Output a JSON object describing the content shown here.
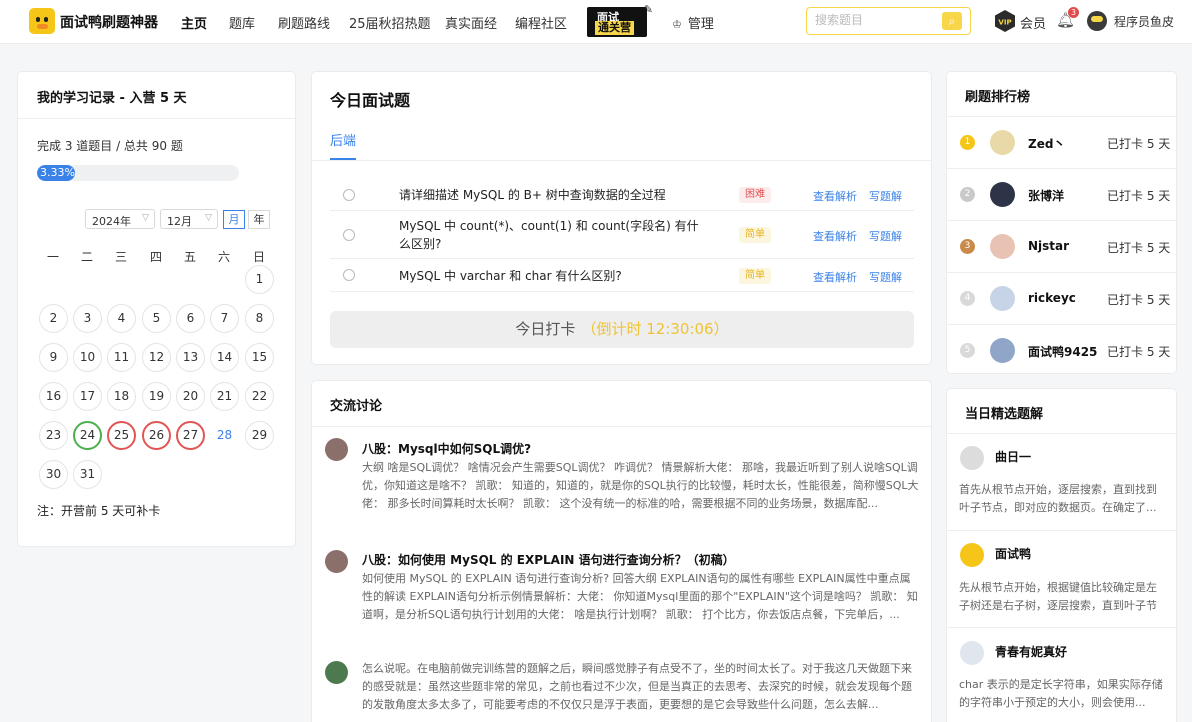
{
  "header": {
    "app_name": "面试鸭刷题神器",
    "nav": [
      "主页",
      "题库",
      "刷题路线",
      "25届秋招热题",
      "真实面经",
      "编程社区"
    ],
    "camp_badge": {
      "line1": "面试",
      "line2": "通关营"
    },
    "admin_label": "管理",
    "search_placeholder": "搜索题目",
    "vip_label": "会员",
    "notification_count": "3",
    "username": "程序员鱼皮"
  },
  "study": {
    "title": "我的学习记录 - 入营 5 天",
    "progress_text": "完成 3 道题目 / 总共 90 题",
    "progress_label": "3.33%",
    "progress_fraction": 0.0333,
    "year": "2024年",
    "month": "12月",
    "mode_month": "月",
    "mode_year": "年",
    "weekdays": [
      "一",
      "二",
      "三",
      "四",
      "五",
      "六",
      "日"
    ],
    "days": [
      "1",
      "2",
      "3",
      "4",
      "5",
      "6",
      "7",
      "8",
      "9",
      "10",
      "11",
      "12",
      "13",
      "14",
      "15",
      "16",
      "17",
      "18",
      "19",
      "20",
      "21",
      "22",
      "23",
      "24",
      "25",
      "26",
      "27",
      "28",
      "29",
      "30",
      "31"
    ],
    "note": "注：开营前 5 天可补卡"
  },
  "today": {
    "title": "今日面试题",
    "tab": "后端",
    "questions": [
      {
        "text": "请详细描述 MySQL 的 B+ 树中查询数据的全过程",
        "tag": "困难",
        "view": "查看解析",
        "write": "写题解"
      },
      {
        "text": "MySQL 中 count(*)、count(1) 和 count(字段名) 有什么区别?",
        "tag": "简单",
        "view": "查看解析",
        "write": "写题解"
      },
      {
        "text": "MySQL 中 varchar 和 char 有什么区别?",
        "tag": "简单",
        "view": "查看解析",
        "write": "写题解"
      }
    ],
    "checkin_label": "今日打卡",
    "checkin_countdown": "（倒计时 12:30:06）"
  },
  "discussion": {
    "title": "交流讨论",
    "posts": [
      {
        "title": "八股：Mysql中如何SQL调优?",
        "body": "大纲 啥是SQL调优？ 啥情况会产生需要SQL调优？ 咋调优？ 情景解析大佬： 那啥，我最近听到了别人说啥SQL调优，你知道这是啥不？ 凯歌： 知道的，知道的，就是你的SQL执行的比较慢，耗时太长，性能很差，简称慢SQL大佬： 那多长时间算耗时太长啊？ 凯歌： 这个没有统一的标准的哈，需要根据不同的业务场景，数据库配..."
      },
      {
        "title": "八股：如何使用 MySQL 的 EXPLAIN 语句进行查询分析？（初稿）",
        "body": "如何使用 MySQL 的 EXPLAIN 语句进行查询分析? 回答大纲 EXPLAIN语句的属性有哪些 EXPLAIN属性中重点属性的解读 EXPLAIN语句分析示例情景解析：大佬： 你知道Mysql里面的那个\"EXPLAIN\"这个词是啥吗？ 凯歌： 知道啊，是分析SQL语句执行计划用的大佬： 啥是执行计划啊？ 凯歌： 打个比方，你去饭店点餐，下完单后，..."
      },
      {
        "title": "",
        "body": "怎么说呢。在电脑前做完训练营的题解之后，瞬间感觉脖子有点受不了，坐的时间太长了。对于我这几天做题下来的感受就是：虽然这些题非常的常见，之前也看过不少次，但是当真正的去思考、去深究的时候，就会发现每个题的发散角度太多太多了，可能要考虑的不仅仅只是浮于表面，更要想的是它会导致些什么问题，怎么去解..."
      }
    ]
  },
  "ranking": {
    "title": "刷题排行榜",
    "rows": [
      {
        "rank": "1",
        "name": "Zed丶",
        "streak": "已打卡 5 天"
      },
      {
        "rank": "2",
        "name": "张博洋",
        "streak": "已打卡 5 天"
      },
      {
        "rank": "3",
        "name": "Njstar",
        "streak": "已打卡 5 天"
      },
      {
        "rank": "4",
        "name": "rickeyc",
        "streak": "已打卡 5 天"
      },
      {
        "rank": "5",
        "name": "面试鸭9425",
        "streak": "已打卡 5 天"
      }
    ]
  },
  "featured": {
    "title": "当日精选题解",
    "items": [
      {
        "name": "曲日一",
        "body": "首先从根节点开始，逐层搜索，直到找到叶子节点，即对应的数据页。在确定了..."
      },
      {
        "name": "面试鸭",
        "body": "先从根节点开始，根据键值比较确定是左子树还是右子树，逐层搜索，直到叶子节点..."
      },
      {
        "name": "青春有妮真好",
        "body": "char 表示的是定长字符串，如果实际存储的字符串小于预定的大小，则会使用..."
      }
    ]
  },
  "colors": {
    "accent": "#3b82e8",
    "brand_yellow": "#f7d64a",
    "danger": "#e25555",
    "success": "#4caf50"
  }
}
